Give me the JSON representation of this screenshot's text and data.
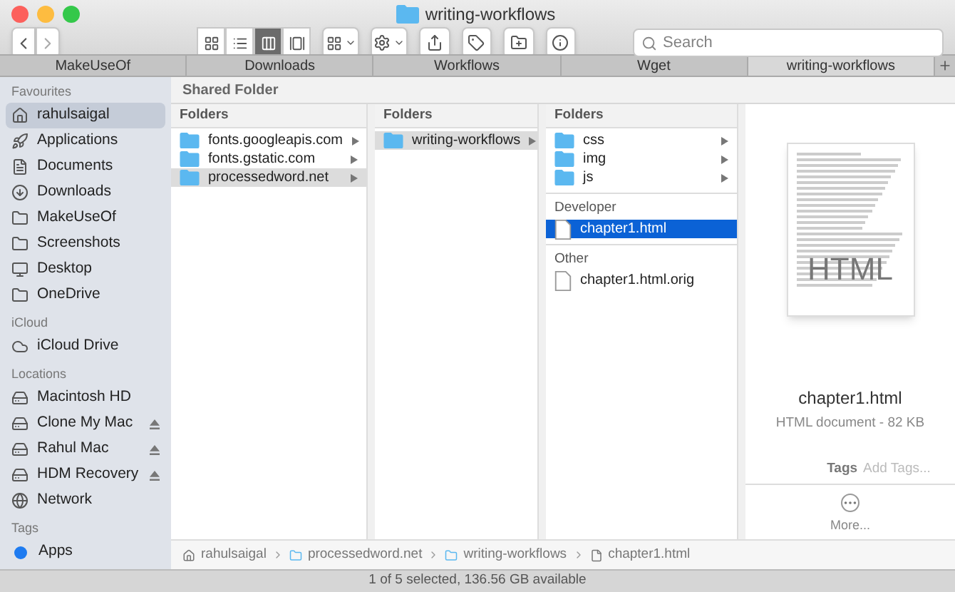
{
  "window": {
    "title": "writing-workflows"
  },
  "toolbar": {
    "search": {
      "placeholder": "Search"
    },
    "view_modes": [
      {
        "kind": "icons",
        "selected": false
      },
      {
        "kind": "list",
        "selected": false
      },
      {
        "kind": "columns",
        "selected": true
      },
      {
        "kind": "gallery",
        "selected": false
      }
    ]
  },
  "tabs": [
    {
      "label": "MakeUseOf",
      "selected": false
    },
    {
      "label": "Downloads",
      "selected": false
    },
    {
      "label": "Workflows",
      "selected": false
    },
    {
      "label": "Wget",
      "selected": false
    },
    {
      "label": "writing-workflows",
      "selected": true
    }
  ],
  "sidebar": {
    "sections": [
      {
        "title": "Favourites",
        "items": [
          {
            "label": "rahulsaigal",
            "kind": "home",
            "selected": true
          },
          {
            "label": "Applications",
            "kind": "apps",
            "selected": false
          },
          {
            "label": "Documents",
            "kind": "docs",
            "selected": false
          },
          {
            "label": "Downloads",
            "kind": "download",
            "selected": false
          },
          {
            "label": "MakeUseOf",
            "kind": "folder",
            "selected": false
          },
          {
            "label": "Screenshots",
            "kind": "folder",
            "selected": false
          },
          {
            "label": "Desktop",
            "kind": "desktop",
            "selected": false
          },
          {
            "label": "OneDrive",
            "kind": "folder",
            "selected": false
          }
        ]
      },
      {
        "title": "iCloud",
        "items": [
          {
            "label": "iCloud Drive",
            "kind": "cloud",
            "selected": false
          }
        ]
      },
      {
        "title": "Locations",
        "items": [
          {
            "label": "Macintosh HD",
            "kind": "disk",
            "selected": false,
            "eject": false
          },
          {
            "label": "Clone My Mac",
            "kind": "disk",
            "selected": false,
            "eject": true
          },
          {
            "label": "Rahul Mac",
            "kind": "disk",
            "selected": false,
            "eject": true
          },
          {
            "label": "HDM Recovery",
            "kind": "disk",
            "selected": false,
            "eject": true
          },
          {
            "label": "Network",
            "kind": "network",
            "selected": false,
            "eject": false
          }
        ]
      },
      {
        "title": "Tags",
        "items": [
          {
            "label": "Apps",
            "kind": "tag",
            "color": "#1e7bf0",
            "selected": false
          }
        ]
      }
    ]
  },
  "shared_folder_header": "Shared Folder",
  "columns": [
    {
      "header": "Folders",
      "groups": [
        {
          "items": [
            {
              "name": "fonts.googleapis.com",
              "kind": "folder",
              "selected": false
            },
            {
              "name": "fonts.gstatic.com",
              "kind": "folder",
              "selected": false
            },
            {
              "name": "processedword.net",
              "kind": "folder",
              "selected": false,
              "highlighted": true
            }
          ]
        }
      ]
    },
    {
      "header": "Folders",
      "groups": [
        {
          "items": [
            {
              "name": "writing-workflows",
              "kind": "folder",
              "selected": false,
              "highlighted": true
            }
          ]
        }
      ]
    },
    {
      "header": "Folders",
      "groups": [
        {
          "items": [
            {
              "name": "css",
              "kind": "folder",
              "selected": false
            },
            {
              "name": "img",
              "kind": "folder",
              "selected": false
            },
            {
              "name": "js",
              "kind": "folder",
              "selected": false
            }
          ]
        },
        {
          "title": "Developer",
          "items": [
            {
              "name": "chapter1.html",
              "kind": "file",
              "selected": true
            }
          ]
        },
        {
          "title": "Other",
          "items": [
            {
              "name": "chapter1.html.orig",
              "kind": "file",
              "selected": false
            }
          ]
        }
      ]
    }
  ],
  "preview": {
    "badge": "HTML",
    "name": "chapter1.html",
    "info": "HTML document - 82 KB",
    "tags_label": "Tags",
    "tags_placeholder": "Add Tags...",
    "more": "More..."
  },
  "path_bar": [
    {
      "label": "rahulsaigal",
      "kind": "home"
    },
    {
      "label": "processedword.net",
      "kind": "folder"
    },
    {
      "label": "writing-workflows",
      "kind": "folder"
    },
    {
      "label": "chapter1.html",
      "kind": "file"
    }
  ],
  "status_bar": "1 of 5 selected, 136.56 GB available"
}
